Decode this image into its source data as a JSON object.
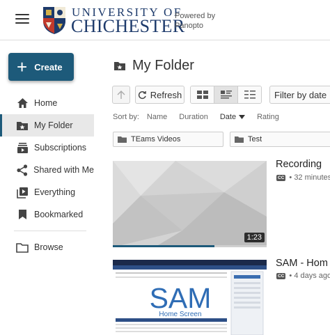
{
  "header": {
    "brand_line1": "UNIVERSITY OF",
    "brand_line2": "CHICHESTER",
    "powered_by": "Powered by Panopto",
    "menu_icon": "hamburger-icon",
    "logo": "university-crest"
  },
  "sidebar": {
    "create_label": "Create",
    "items": [
      {
        "label": "Home",
        "icon": "home-icon"
      },
      {
        "label": "My Folder",
        "icon": "starred-folder-icon",
        "active": true
      },
      {
        "label": "Subscriptions",
        "icon": "subscriptions-icon"
      },
      {
        "label": "Shared with Me",
        "icon": "share-icon"
      },
      {
        "label": "Everything",
        "icon": "play-stack-icon"
      },
      {
        "label": "Bookmarked",
        "icon": "bookmark-icon"
      },
      {
        "label": "Browse",
        "icon": "folder-outline-icon"
      }
    ]
  },
  "main": {
    "folder_title": "My Folder",
    "toolbar": {
      "refresh_label": "Refresh",
      "filter_label": "Filter by date"
    },
    "sort": {
      "label": "Sort by:",
      "options": [
        "Name",
        "Duration",
        "Date",
        "Rating"
      ],
      "selected": "Date",
      "direction": "descending"
    },
    "subfolders": [
      {
        "name": "TEams Videos"
      },
      {
        "name": "Test"
      }
    ],
    "sessions": [
      {
        "title": "Recording",
        "meta": "32 minutes",
        "duration": "1:23",
        "watched_fraction": 0.66,
        "captions": "CC"
      },
      {
        "title": "SAM - Hom",
        "meta": "4 days ago",
        "captions": "CC",
        "thumb_text": "SAM",
        "thumb_subtext": "Home Screen"
      }
    ]
  },
  "colors": {
    "accent": "#1d5a7a",
    "brand": "#1d3a6b",
    "active_nav_bg": "#e8e8e8"
  }
}
